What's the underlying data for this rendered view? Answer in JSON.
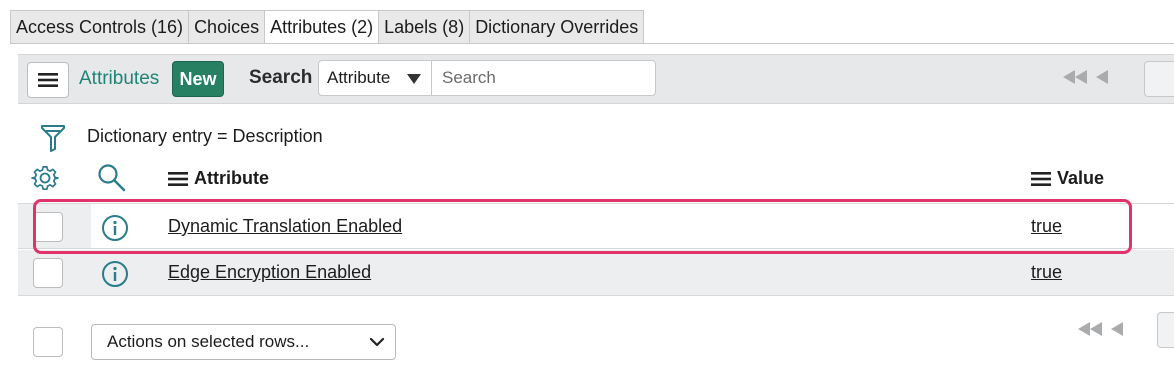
{
  "tabs": [
    {
      "label": "Access Controls (16)",
      "active": false
    },
    {
      "label": "Choices",
      "active": false
    },
    {
      "label": "Attributes (2)",
      "active": true
    },
    {
      "label": "Labels (8)",
      "active": false
    },
    {
      "label": "Dictionary Overrides",
      "active": false
    }
  ],
  "toolbar": {
    "list_title": "Attributes",
    "new_label": "New",
    "search_label": "Search",
    "search_field": "Attribute",
    "search_placeholder": "Search"
  },
  "filter": {
    "text": "Dictionary entry = Description"
  },
  "columns": {
    "attribute": "Attribute",
    "value": "Value"
  },
  "rows": [
    {
      "attribute": "Dynamic Translation Enabled",
      "value": "true",
      "highlighted": true
    },
    {
      "attribute": "Edge Encryption Enabled",
      "value": "true",
      "highlighted": false
    }
  ],
  "footer": {
    "actions_label": "Actions on selected rows..."
  },
  "colors": {
    "accent": "#1f8476",
    "new_button": "#278062",
    "highlight": "#e0336a"
  },
  "icons": [
    "menu-icon",
    "caret-down-icon",
    "first-page-icon",
    "previous-page-icon",
    "filter-icon",
    "gear-icon",
    "search-icon",
    "info-icon",
    "chevron-down-icon"
  ]
}
